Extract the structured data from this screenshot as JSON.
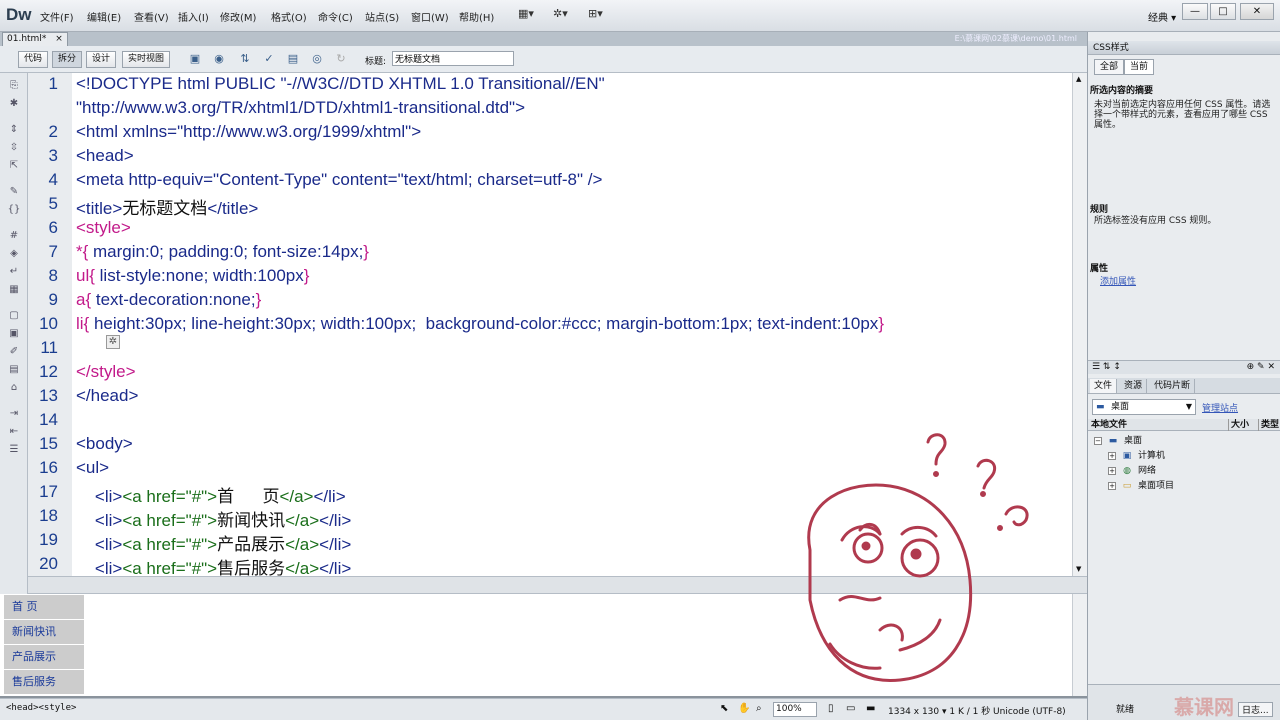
{
  "app": {
    "logo": "Dw",
    "workspace": "经典 ▾"
  },
  "menu": [
    "文件(F)",
    "编辑(E)",
    "查看(V)",
    "插入(I)",
    "修改(M)",
    "格式(O)",
    "命令(C)",
    "站点(S)",
    "窗口(W)",
    "帮助(H)"
  ],
  "toolbar_icons": [
    "layout-icon",
    "gear-icon",
    "sitemap-icon"
  ],
  "window_buttons": {
    "minimize": "—",
    "maximize": "□",
    "close": "✕"
  },
  "document": {
    "tab": "01.html*",
    "tab_close": "×",
    "path": "E:\\慕课网\\02慕课\\demo\\01.html",
    "view_buttons": [
      "代码",
      "拆分",
      "设计",
      "实时视图"
    ],
    "title_label": "标题:",
    "title_value": "无标题文档"
  },
  "code_lines": [
    {
      "n": "1",
      "html": "<span class='tag'>&lt;!DOCTYPE html PUBLIC \"-//W3C//DTD XHTML 1.0 Transitional//EN\"</span>"
    },
    {
      "n": "",
      "html": "<span class='tag'>\"http://www.w3.org/TR/xhtml1/DTD/xhtml1-transitional.dtd\"&gt;</span>"
    },
    {
      "n": "2",
      "html": "<span class='tag'>&lt;html xmlns=\"http://www.w3.org/1999/xhtml\"&gt;</span>"
    },
    {
      "n": "3",
      "html": "<span class='tag'>&lt;head&gt;</span>"
    },
    {
      "n": "4",
      "html": "<span class='tag'>&lt;meta http-equiv=\"Content-Type\" content=\"text/html; charset=utf-8\" /&gt;</span>"
    },
    {
      "n": "5",
      "html": "<span class='tag'>&lt;title&gt;</span><span class='txt'>无标题文档</span><span class='tag'>&lt;/title&gt;</span>"
    },
    {
      "n": "6",
      "html": "<span class='css'>&lt;style&gt;</span>"
    },
    {
      "n": "7",
      "html": "<span class='css'>*{</span><span class='val'> margin:0; padding:0; font-size:14px;</span><span class='css'>}</span>"
    },
    {
      "n": "8",
      "html": "<span class='css'>ul{</span><span class='val'> list-style:none; width:100px</span><span class='css'>}</span>"
    },
    {
      "n": "9",
      "html": "<span class='css'>a{</span><span class='val'> text-decoration:none;</span><span class='css'>}</span>"
    },
    {
      "n": "10",
      "html": "<span class='css'>li{</span><span class='val'> height:30px; line-height:30px; width:100px;  background-color:#ccc; margin-bottom:1px; text-indent:10px</span><span class='css'>}</span>"
    },
    {
      "n": "11",
      "html": ""
    },
    {
      "n": "12",
      "html": "<span class='css'>&lt;/style&gt;</span>"
    },
    {
      "n": "13",
      "html": "<span class='tag'>&lt;/head&gt;</span>"
    },
    {
      "n": "14",
      "html": ""
    },
    {
      "n": "15",
      "html": "<span class='tag'>&lt;body&gt;</span>"
    },
    {
      "n": "16",
      "html": "<span class='tag'>&lt;ul&gt;</span>"
    },
    {
      "n": "17",
      "html": "    <span class='tag'>&lt;li&gt;</span><span class='grn'>&lt;a href=\"#\"&gt;</span><span class='txt'>首      页</span><span class='grn'>&lt;/a&gt;</span><span class='tag'>&lt;/li&gt;</span>"
    },
    {
      "n": "18",
      "html": "    <span class='tag'>&lt;li&gt;</span><span class='grn'>&lt;a href=\"#\"&gt;</span><span class='txt'>新闻快讯</span><span class='grn'>&lt;/a&gt;</span><span class='tag'>&lt;/li&gt;</span>"
    },
    {
      "n": "19",
      "html": "    <span class='tag'>&lt;li&gt;</span><span class='grn'>&lt;a href=\"#\"&gt;</span><span class='txt'>产品展示</span><span class='grn'>&lt;/a&gt;</span><span class='tag'>&lt;/li&gt;</span>"
    },
    {
      "n": "20",
      "html": "    <span class='tag'>&lt;li&gt;</span><span class='grn'>&lt;a href=\"#\"&gt;</span><span class='txt'>售后服务</span><span class='grn'>&lt;/a&gt;</span><span class='tag'>&lt;/li&gt;</span>"
    }
  ],
  "design_nav": [
    "首      页",
    "新闻快讯",
    "产品展示",
    "售后服务"
  ],
  "status": {
    "tag_selector": "<head><style>",
    "zoom": "100%",
    "info": "1334 x 130 ▾  1 K / 1 秒  Unicode (UTF-8)"
  },
  "css_panel": {
    "header": "CSS样式",
    "tabs": [
      "全部",
      "当前"
    ],
    "summary_title": "所选内容的摘要",
    "summary_text": "未对当前选定内容应用任何 CSS 属性。请选择一个带样式的元素，查看应用了哪些 CSS 属性。",
    "rules_title": "规则",
    "rules_text": "所选标签没有应用 CSS 规则。",
    "props_title": "属性",
    "add_property": "添加属性"
  },
  "files_panel": {
    "tabs": [
      "文件",
      "资源",
      "代码片断"
    ],
    "site": "桌面",
    "manage": "管理站点",
    "columns": [
      "本地文件",
      "大小",
      "类型"
    ],
    "tree": [
      {
        "label": "桌面",
        "icon": "desktop-icon",
        "indent": 0
      },
      {
        "label": "计算机",
        "icon": "computer-icon",
        "indent": 1
      },
      {
        "label": "网络",
        "icon": "network-icon",
        "indent": 1
      },
      {
        "label": "桌面项目",
        "icon": "folder-icon",
        "indent": 1
      }
    ],
    "bottom_ready": "就绪",
    "bottom_log": "日志..."
  },
  "watermark": "慕课网"
}
